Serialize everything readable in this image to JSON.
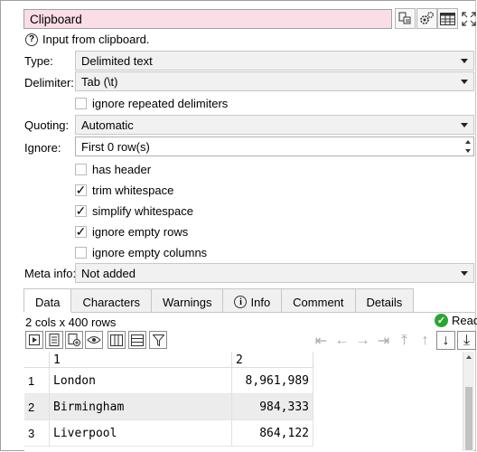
{
  "title": "Clipboard",
  "info_text": "Input from clipboard.",
  "fields": {
    "type_label": "Type:",
    "type_value": "Delimited text",
    "delimiter_label": "Delimiter:",
    "delimiter_value": "Tab (\\t)",
    "ignore_repeated": "ignore repeated delimiters",
    "quoting_label": "Quoting:",
    "quoting_value": "Automatic",
    "ignore_label": "Ignore:",
    "ignore_value": "First 0 row(s)",
    "has_header": "has header",
    "trim_whitespace": "trim whitespace",
    "simplify_whitespace": "simplify whitespace",
    "ignore_empty_rows": "ignore empty rows",
    "ignore_empty_columns": "ignore empty columns",
    "meta_label": "Meta info:",
    "meta_value": "Not added"
  },
  "checkboxes": {
    "ignore_repeated": false,
    "has_header": false,
    "trim_whitespace": true,
    "simplify_whitespace": true,
    "ignore_empty_rows": true,
    "ignore_empty_columns": false
  },
  "check_mark": "✓",
  "tabs": [
    "Data",
    "Characters",
    "Warnings",
    "Info",
    "Comment",
    "Details"
  ],
  "info_tab_icon": "i",
  "summary": "2 cols x 400 rows",
  "status": "Read",
  "table": {
    "headers": [
      "1",
      "2"
    ],
    "rows": [
      {
        "num": "1",
        "c1": "London",
        "c2": "8,961,989"
      },
      {
        "num": "2",
        "c1": "Birmingham",
        "c2": "984,333"
      },
      {
        "num": "3",
        "c1": "Liverpool",
        "c2": "864,122"
      }
    ]
  },
  "icons": {
    "title_buttons": [
      "copy-settings-icon",
      "gear-icon",
      "table-view-icon",
      "maximize-icon"
    ],
    "toolbar": [
      "play-icon",
      "column-list-icon",
      "add-record-icon",
      "eye-icon",
      "columns-icon",
      "rows-icon",
      "filter-icon"
    ],
    "nav": [
      "first-icon",
      "prev-icon",
      "next-icon",
      "last-icon",
      "top-icon",
      "up-icon",
      "down-icon",
      "bottom-icon"
    ]
  },
  "colors": {
    "title_bg": "#fbdde6",
    "status_ok": "#2aa52f",
    "selected_row": "#ececec"
  }
}
